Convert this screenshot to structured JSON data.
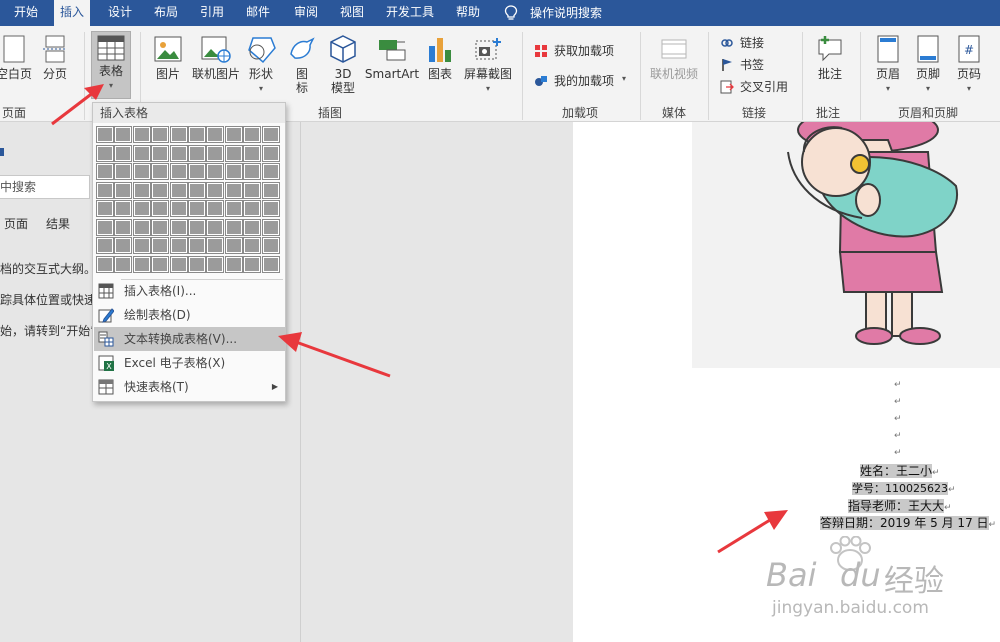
{
  "tabs": [
    "开始",
    "插入",
    "设计",
    "布局",
    "引用",
    "邮件",
    "审阅",
    "视图",
    "开发工具",
    "帮助"
  ],
  "active_tab": "插入",
  "tell_me": "操作说明搜索",
  "ribbon": {
    "pages_group": {
      "blank_page": "空白页",
      "page_break": "分页",
      "label": "页面"
    },
    "table_group": {
      "table": "表格"
    },
    "illustrations": {
      "picture": "图片",
      "online_picture": "联机图片",
      "shapes": "形状",
      "icons_1": "图",
      "icons_2": "标",
      "model_1": "3D",
      "model_2": "模型",
      "smartart": "SmartArt",
      "chart": "图表",
      "screenshot": "屏幕截图",
      "label": "插图"
    },
    "addins": {
      "get": "获取加载项",
      "mine": "我的加载项",
      "label": "加载项"
    },
    "media": {
      "online_video": "联机视频",
      "label": "媒体"
    },
    "links": {
      "link": "链接",
      "bookmark": "书签",
      "cross_ref": "交叉引用",
      "label": "链接"
    },
    "comments": {
      "comment": "批注",
      "label": "批注"
    },
    "header_footer": {
      "header": "页眉",
      "footer": "页脚",
      "page_number": "页码",
      "label": "页眉和页脚"
    }
  },
  "dropdown": {
    "title": "插入表格",
    "items": [
      {
        "label": "插入表格(I)...",
        "icon": "table-icon"
      },
      {
        "label": "绘制表格(D)",
        "icon": "pencil-table-icon"
      },
      {
        "label": "文本转换成表格(V)...",
        "icon": "text-to-table-icon"
      },
      {
        "label": "Excel 电子表格(X)",
        "icon": "excel-icon"
      },
      {
        "label": "快速表格(T)",
        "icon": "quick-table-icon"
      }
    ]
  },
  "nav": {
    "search_placeholder": "中搜索",
    "tab_pages": "页面",
    "tab_results": "结果",
    "line1": "档的交互式大纲。",
    "line2": "踪具体位置或快速",
    "line3": "始，请转到“开始”"
  },
  "document": {
    "name": "姓名：王二小",
    "student_id": "学号：110025623",
    "advisor": "指导老师：王大大",
    "defense_date": "答辩日期：2019 年 5 月 17 日"
  },
  "watermark": {
    "brand_left": "Bai",
    "brand_right": "du",
    "cn": "经验",
    "url": "jingyan.baidu.com"
  },
  "colors": {
    "ribbon_blue": "#2b579a",
    "arrow_red": "#e8383d",
    "grid_gray": "#9b9b9b"
  }
}
